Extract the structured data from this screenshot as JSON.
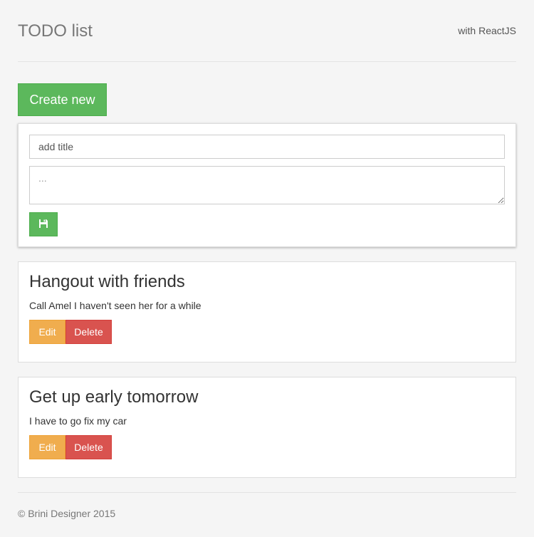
{
  "header": {
    "title": "TODO list",
    "subtitle": "with ReactJS"
  },
  "create_button": {
    "label": "Create new"
  },
  "form": {
    "title_value": "add title",
    "description_placeholder": "...",
    "save_icon": "floppy-disk-icon"
  },
  "todos": [
    {
      "title": "Hangout with friends",
      "description": "Call Amel I haven't seen her for a while",
      "edit_label": "Edit",
      "delete_label": "Delete"
    },
    {
      "title": "Get up early tomorrow",
      "description": "I have to go fix my car",
      "edit_label": "Edit",
      "delete_label": "Delete"
    }
  ],
  "footer": {
    "text": "© Brini Designer 2015"
  },
  "colors": {
    "success": "#5cb85c",
    "warning": "#f0ad4e",
    "danger": "#d9534f",
    "background": "#f5f5f5"
  }
}
